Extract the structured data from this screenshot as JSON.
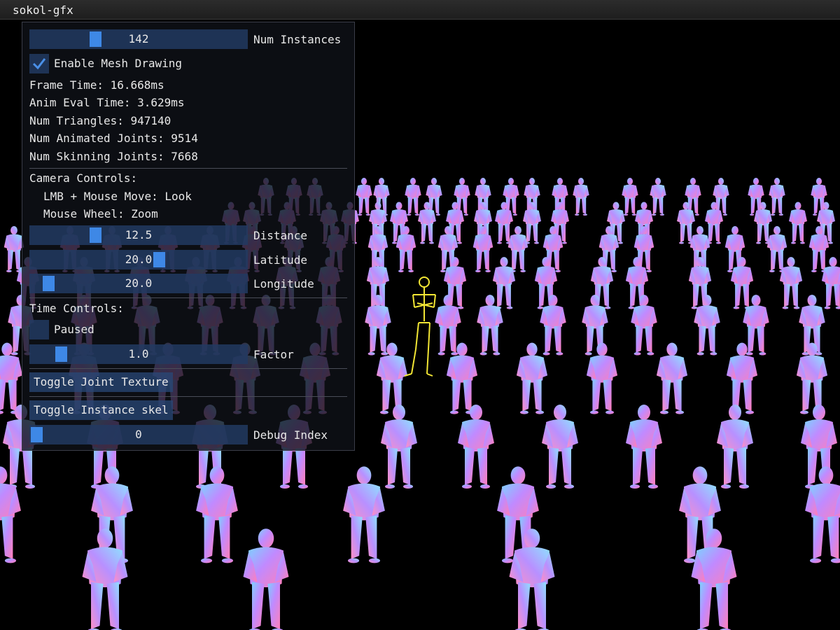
{
  "window": {
    "title": "sokol-gfx"
  },
  "scene": {
    "description_icon": "crowd-of-animated-characters"
  },
  "panel": {
    "num_instances": {
      "value": "142",
      "label": "Num Instances",
      "fraction": 0.29
    },
    "enable_mesh": {
      "label": "Enable Mesh Drawing",
      "checked": true
    },
    "stats": {
      "frame_time": "Frame Time: 16.668ms",
      "anim_eval_time": "Anim Eval Time: 3.629ms",
      "num_triangles": "Num Triangles: 947140",
      "num_animated_joints": "Num Animated Joints: 9514",
      "num_skinning_joints": "Num Skinning Joints: 7668"
    },
    "camera": {
      "header": "Camera Controls:",
      "hint_look": "LMB + Mouse Move: Look",
      "hint_zoom": "Mouse Wheel: Zoom",
      "distance": {
        "value": "12.5",
        "label": "Distance",
        "fraction": 0.29
      },
      "latitude": {
        "value": "20.0",
        "label": "Latitude",
        "fraction": 0.6
      },
      "longitude": {
        "value": "20.0",
        "label": "Longitude",
        "fraction": 0.06
      }
    },
    "time": {
      "header": "Time Controls:",
      "paused": {
        "label": "Paused",
        "checked": false
      },
      "factor": {
        "value": "1.0",
        "label": "Factor",
        "fraction": 0.12
      }
    },
    "buttons": {
      "toggle_joint_texture": "Toggle Joint Texture",
      "toggle_instance_skel": "Toggle Instance skel"
    },
    "debug_index": {
      "value": "0",
      "label": "Debug Index",
      "fraction": 0.0
    }
  },
  "colors": {
    "slider_bg": "#223a62",
    "slider_grab": "#3e88e6",
    "checkmark": "#4a90e8",
    "skeleton": "#f2e634",
    "background": "#000000"
  }
}
